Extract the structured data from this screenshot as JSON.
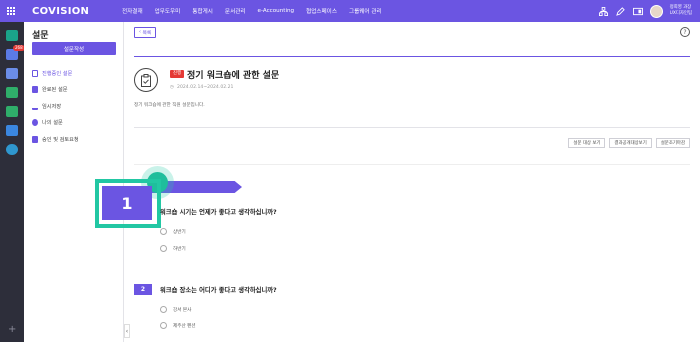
{
  "header": {
    "logo": "COVISION",
    "nav": [
      "전자결재",
      "업무도우미",
      "통합게시",
      "문서관리",
      "e-Accounting",
      "협업스페이스",
      "그룹웨어 관리"
    ],
    "user": {
      "name": "정희영 과장",
      "dept": "UX디자인팀"
    }
  },
  "rail": {
    "mail_badge": "268"
  },
  "sidebar": {
    "title": "설문",
    "create_button": "설문작성",
    "items": [
      {
        "label": "진행중인 설문",
        "active": true
      },
      {
        "label": "완료된 설문"
      },
      {
        "label": "임시저장"
      },
      {
        "label": "나의 설문"
      },
      {
        "label": "승인 및 검토요청"
      }
    ]
  },
  "content": {
    "back_label": "목록",
    "help": "?",
    "status_badge": "진행",
    "title": "정기 워크숍에 관한 설문",
    "period": "2024.02.14~2024.02.21",
    "description": "정기 워크숍에 관한 직원 설문입니다.",
    "actions": [
      "설문 대상 보기",
      "결과공개대상보기",
      "설문조기마감"
    ],
    "questions": [
      {
        "number": "1",
        "text": "워크숍 시기는 언제가 좋다고 생각하십니까?",
        "options": [
          "상반기",
          "하반기"
        ]
      },
      {
        "number": "2",
        "text": "워크숍 장소는 어디가 좋다고 생각하십니까?",
        "options": [
          "강서 본사",
          "제주산 펜션"
        ]
      }
    ]
  },
  "colors": {
    "primary": "#6b55e2",
    "accent": "#22c7a3",
    "danger": "#e53935"
  }
}
